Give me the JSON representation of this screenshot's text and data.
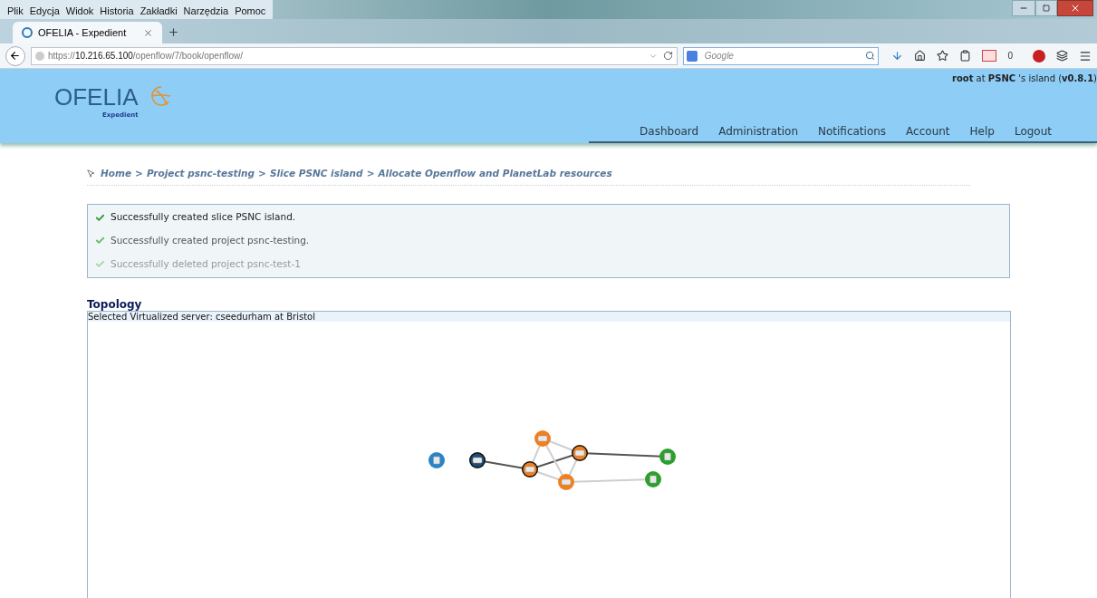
{
  "menu_bar": [
    "Plik",
    "Edycja",
    "Widok",
    "Historia",
    "Zakładki",
    "Narzędzia",
    "Pomoc"
  ],
  "tabs": [
    {
      "label": "OFELIA - Expedient",
      "selected": true
    }
  ],
  "address_bar": {
    "scheme": "https://",
    "host": "10.216.65.100",
    "path": "/openflow/7/book/openflow/"
  },
  "search": {
    "placeholder": "Google"
  },
  "toolbar": {
    "counter": "0"
  },
  "header": {
    "logo_text": "OFELIA",
    "logo_subtext": "Expedient",
    "user": "root",
    "at": "at",
    "island": "PSNC",
    "island_suffix": "'s island (",
    "version": "v0.8.1",
    "version_close": ")"
  },
  "nav": [
    {
      "label": "Dashboard"
    },
    {
      "label": "Administration"
    },
    {
      "label": "Notifications"
    },
    {
      "label": "Account"
    },
    {
      "label": "Help"
    },
    {
      "label": "Logout"
    }
  ],
  "breadcrumb": {
    "separator": ">",
    "items": [
      "Home",
      "Project psnc-testing",
      "Slice PSNC island",
      "Allocate Openflow and PlanetLab resources"
    ]
  },
  "messages": [
    {
      "text": "Successfully created slice PSNC island.",
      "kind": "new"
    },
    {
      "text": "Successfully created project psnc-testing.",
      "kind": "older"
    },
    {
      "text": "Successfully deleted project psnc-test-1",
      "kind": "oldest"
    }
  ],
  "topology": {
    "title": "Topology",
    "status": "Selected Virtualized server: cseedurham at Bristol",
    "nodes": [
      {
        "kind": "server",
        "color": "#2a85c8",
        "selected": false
      },
      {
        "kind": "switch",
        "color": "#1f4e74",
        "selected": true
      },
      {
        "kind": "switch",
        "color": "#f08020",
        "selected": false
      },
      {
        "kind": "switch",
        "color": "#f08020",
        "selected": true
      },
      {
        "kind": "switch",
        "color": "#f08020",
        "selected": true
      },
      {
        "kind": "switch",
        "color": "#f08020",
        "selected": false
      },
      {
        "kind": "server",
        "color": "#2ca02c",
        "selected": false
      },
      {
        "kind": "server",
        "color": "#2ca02c",
        "selected": false
      }
    ],
    "links": [
      {
        "highlighted": true
      },
      {
        "highlighted": true
      },
      {
        "highlighted": true
      },
      {
        "highlighted": false
      },
      {
        "highlighted": false
      },
      {
        "highlighted": false
      },
      {
        "highlighted": false
      },
      {
        "highlighted": false
      },
      {
        "highlighted": false
      }
    ]
  }
}
